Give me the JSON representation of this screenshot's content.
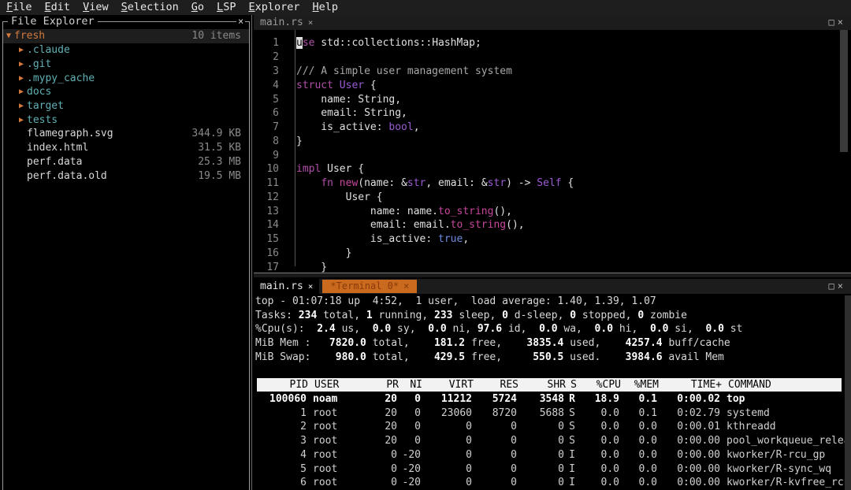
{
  "menu": [
    "File",
    "Edit",
    "View",
    "Selection",
    "Go",
    "LSP",
    "Explorer",
    "Help"
  ],
  "explorer": {
    "title": "File Explorer",
    "close": "×",
    "root": {
      "name": "fresh",
      "meta": "10 items"
    },
    "items": [
      {
        "name": ".claude",
        "type": "dir",
        "meta": ""
      },
      {
        "name": ".git",
        "type": "dir",
        "meta": ""
      },
      {
        "name": ".mypy_cache",
        "type": "dir",
        "meta": ""
      },
      {
        "name": "docs",
        "type": "dir",
        "meta": ""
      },
      {
        "name": "target",
        "type": "dir",
        "meta": ""
      },
      {
        "name": "tests",
        "type": "dir",
        "meta": ""
      },
      {
        "name": "flamegraph.svg",
        "type": "file",
        "meta": "344.9 KB"
      },
      {
        "name": "index.html",
        "type": "file",
        "meta": "31.5 KB"
      },
      {
        "name": "perf.data",
        "type": "file",
        "meta": "25.3 MB"
      },
      {
        "name": "perf.data.old",
        "type": "file",
        "meta": "19.5 MB"
      }
    ]
  },
  "editor": {
    "tab": "main.rs",
    "tab_close": "×",
    "pane_controls": "□×",
    "line_numbers": [
      "1",
      "2",
      "3",
      "4",
      "5",
      "6",
      "7",
      "8",
      "9",
      "10",
      "11",
      "12",
      "13",
      "14",
      "15",
      "16",
      "17"
    ]
  },
  "terminal": {
    "tabs": [
      {
        "label": "main.rs",
        "close": "×"
      },
      {
        "label": "*Terminal 0*",
        "close": "×"
      }
    ],
    "pane_controls": "□×",
    "summary": [
      "top - 01:07:18 up  4:52,  1 user,  load average: 1.40, 1.39, 1.07"
    ],
    "tasks": {
      "total": "234",
      "running": "1",
      "sleeping": "233",
      "dsleep": "0",
      "stopped": "0",
      "zombie": "0"
    },
    "cpu": {
      "us": "2.4",
      "sy": "0.0",
      "ni": "0.0",
      "id": "97.6",
      "wa": "0.0",
      "hi": "0.0",
      "si": "0.0",
      "st": "0.0"
    },
    "mem": {
      "total": "7820.0",
      "free": "181.2",
      "used": "3835.4",
      "buff": "4257.4"
    },
    "swap": {
      "total": "980.0",
      "free": "429.5",
      "used": "550.5",
      "avail": "3984.6"
    },
    "columns": [
      "PID",
      "USER",
      "PR",
      "NI",
      "VIRT",
      "RES",
      "SHR",
      "S",
      "%CPU",
      "%MEM",
      "TIME+",
      "COMMAND"
    ],
    "processes": [
      [
        "100060",
        "noam",
        "20",
        "0",
        "11212",
        "5724",
        "3548",
        "R",
        "18.9",
        "0.1",
        "0:00.02",
        "top"
      ],
      [
        "1",
        "root",
        "20",
        "0",
        "23060",
        "8720",
        "5688",
        "S",
        "0.0",
        "0.1",
        "0:02.79",
        "systemd"
      ],
      [
        "2",
        "root",
        "20",
        "0",
        "0",
        "0",
        "0",
        "S",
        "0.0",
        "0.0",
        "0:00.01",
        "kthreadd"
      ],
      [
        "3",
        "root",
        "20",
        "0",
        "0",
        "0",
        "0",
        "S",
        "0.0",
        "0.0",
        "0:00.00",
        "pool_workqueue_release"
      ],
      [
        "4",
        "root",
        "0",
        "-20",
        "0",
        "0",
        "0",
        "I",
        "0.0",
        "0.0",
        "0:00.00",
        "kworker/R-rcu_gp"
      ],
      [
        "5",
        "root",
        "0",
        "-20",
        "0",
        "0",
        "0",
        "I",
        "0.0",
        "0.0",
        "0:00.00",
        "kworker/R-sync_wq"
      ],
      [
        "6",
        "root",
        "0",
        "-20",
        "0",
        "0",
        "0",
        "I",
        "0.0",
        "0.0",
        "0:00.00",
        "kworker/R-kvfree_rcu_re+"
      ]
    ]
  }
}
